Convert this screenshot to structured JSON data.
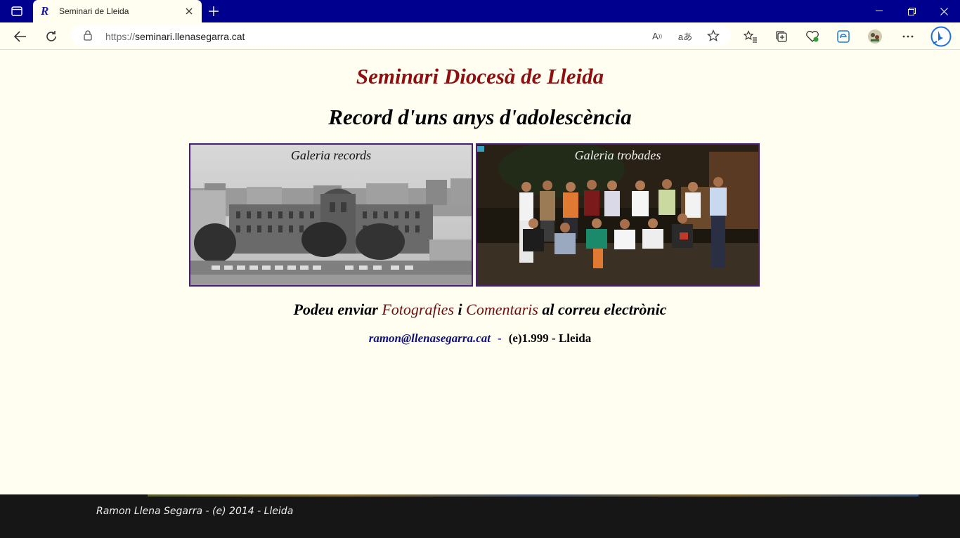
{
  "browser": {
    "tab_title": "Seminari de Lleida",
    "url_scheme": "https://",
    "url_host": "seminari.llenasegarra.cat",
    "colors": {
      "tabbar": "#00008e"
    }
  },
  "page": {
    "title": "Seminari Diocesà de Lleida",
    "subtitle": "Record d'uns anys d'adolescència",
    "galleries": [
      {
        "label": "Galeria records",
        "kind": "black-and-white photo of seminary building"
      },
      {
        "label": "Galeria trobades",
        "kind": "color group photo"
      }
    ],
    "send_line": {
      "part1": "Podeu enviar ",
      "link1": "Fotografies",
      "part2": " i ",
      "link2": "Comentaris",
      "part3": " al correu electrònic"
    },
    "contact": {
      "email": "ramon@llenasegarra.cat",
      "separator": "-",
      "copyright": "(e)1.999 - Lleida"
    },
    "colors": {
      "title": "#8f0f10",
      "background": "#fffef0",
      "link": "#0d0d80"
    }
  },
  "footer": {
    "text": "Ramon Llena Segarra - (e) 2014 - Lleida"
  }
}
